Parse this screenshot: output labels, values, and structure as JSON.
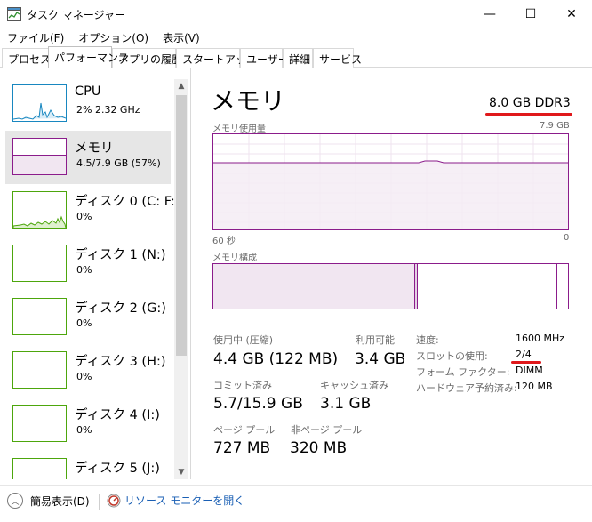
{
  "window": {
    "title": "タスク マネージャー",
    "minimize_glyph": "—",
    "maximize_glyph": "☐",
    "close_glyph": "✕"
  },
  "menu": [
    "ファイル(F)",
    "オプション(O)",
    "表示(V)"
  ],
  "tabs": [
    "プロセス",
    "パフォーマンス",
    "アプリの履歴",
    "スタートアップ",
    "ユーザー",
    "詳細",
    "サービス"
  ],
  "active_tab": "パフォーマンス",
  "sidebar": {
    "items": [
      {
        "name": "CPU",
        "value": "2%  2.32 GHz",
        "kind": "cpu"
      },
      {
        "name": "メモリ",
        "value": "4.5/7.9 GB (57%)",
        "kind": "memory",
        "selected": true
      },
      {
        "name": "ディスク 0 (C: F:)",
        "value": "0%",
        "kind": "disk"
      },
      {
        "name": "ディスク 1 (N:)",
        "value": "0%",
        "kind": "disk"
      },
      {
        "name": "ディスク 2 (G:)",
        "value": "0%",
        "kind": "disk"
      },
      {
        "name": "ディスク 3 (H:)",
        "value": "0%",
        "kind": "disk"
      },
      {
        "name": "ディスク 4 (I:)",
        "value": "0%",
        "kind": "disk"
      },
      {
        "name": "ディスク 5 (J:)",
        "value": "",
        "kind": "disk"
      }
    ]
  },
  "memory": {
    "title": "メモリ",
    "spec": "8.0 GB DDR3",
    "usage_graph": {
      "label": "メモリ使用量",
      "max_label": "7.9 GB",
      "left_axis": "60 秒",
      "right_axis": "0",
      "usage_fraction": 0.57
    },
    "composition_label": "メモリ構成",
    "composition": {
      "in_use_fraction": 0.57,
      "standby_fraction": 0.39
    },
    "stats": {
      "in_use_label": "使用中 (圧縮)",
      "in_use_value": "4.4 GB (122 MB)",
      "available_label": "利用可能",
      "available_value": "3.4 GB",
      "committed_label": "コミット済み",
      "committed_value": "5.7/15.9 GB",
      "cached_label": "キャッシュ済み",
      "cached_value": "3.1 GB",
      "paged_label": "ページ プール",
      "paged_value": "727 MB",
      "nonpaged_label": "非ページ プール",
      "nonpaged_value": "320 MB"
    },
    "properties": [
      {
        "label": "速度:",
        "value": "1600 MHz"
      },
      {
        "label": "スロットの使用:",
        "value": "2/4"
      },
      {
        "label": "フォーム ファクター:",
        "value": "DIMM"
      },
      {
        "label": "ハードウェア予約済み:",
        "value": "120 MB"
      }
    ]
  },
  "footer": {
    "fewer_details": "簡易表示(D)",
    "resource_monitor": "リソース モニターを開く"
  },
  "colors": {
    "memory_accent": "#8b1c8b",
    "cpu_accent": "#1887c0",
    "disk_accent": "#4da60c",
    "highlight_underline": "#e0181b"
  }
}
